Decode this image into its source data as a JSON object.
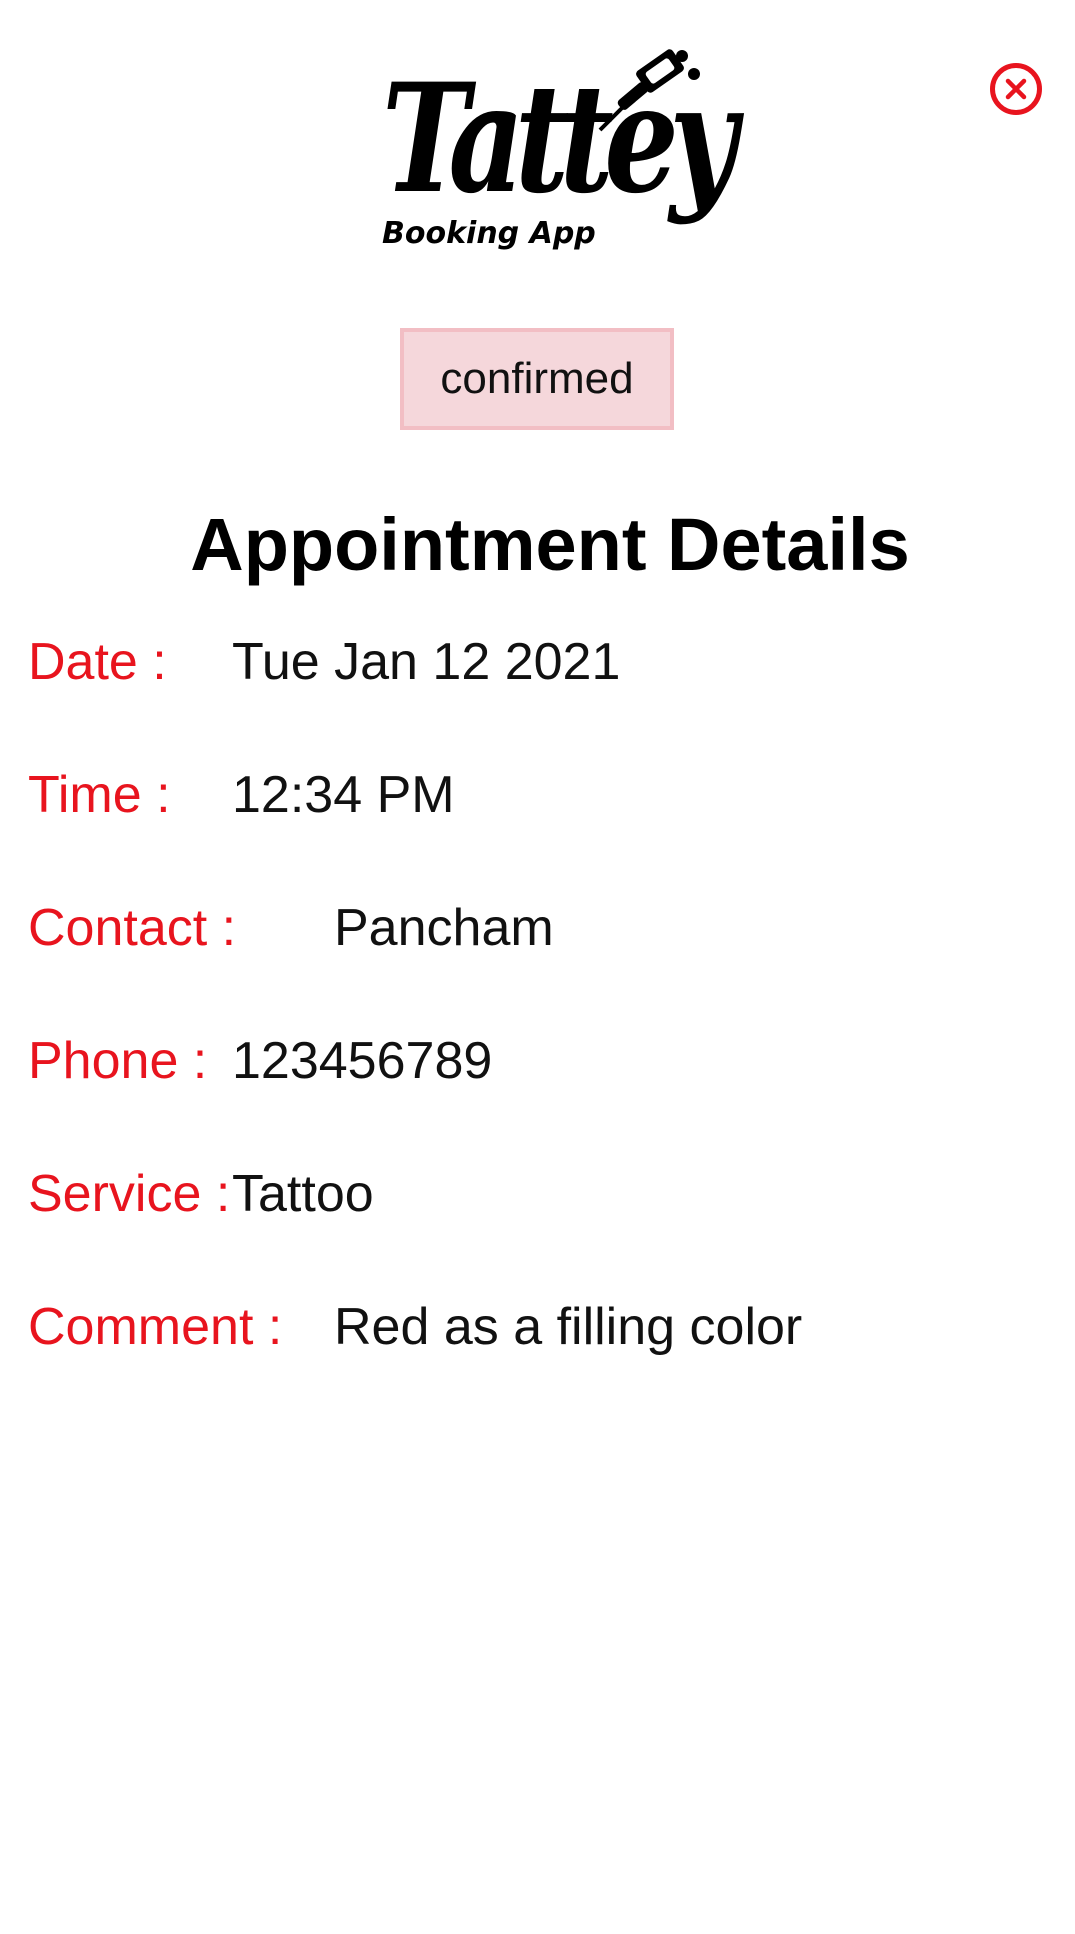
{
  "logo": {
    "script_text": "Tattey",
    "subtitle": "Booking App"
  },
  "close_icon": "close-circle-icon",
  "status": "confirmed",
  "title": "Appointment Details",
  "colors": {
    "label": "#e8141e",
    "badge_bg": "#f5d7db",
    "badge_border": "#f2bec4"
  },
  "details": {
    "date": {
      "label": "Date :",
      "value": "Tue Jan 12 2021"
    },
    "time": {
      "label": "Time :",
      "value": "12:34 PM"
    },
    "contact": {
      "label": "Contact :",
      "value": "Pancham"
    },
    "phone": {
      "label": "Phone :",
      "value": "123456789"
    },
    "service": {
      "label": "Service :",
      "value": "Tattoo"
    },
    "comment": {
      "label": "Comment :",
      "value": "Red as a filling color"
    }
  }
}
